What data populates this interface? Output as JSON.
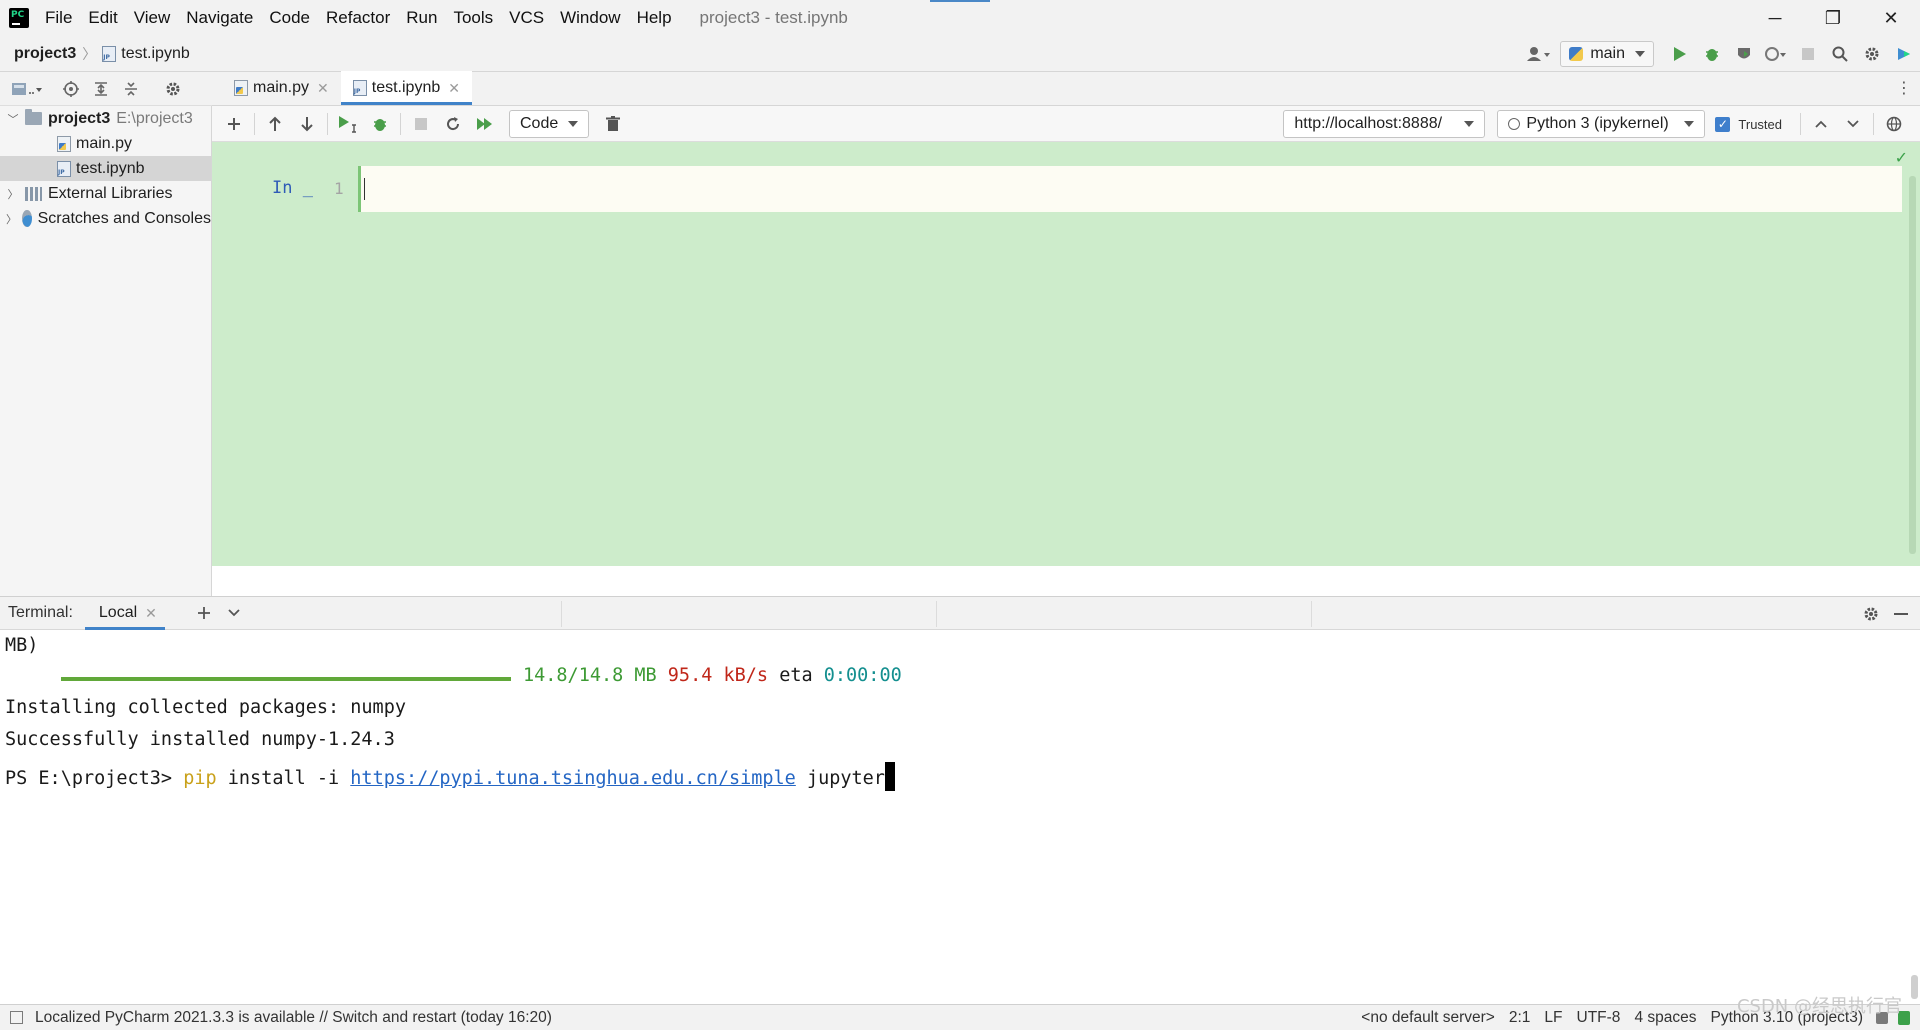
{
  "menubar": {
    "items": [
      "File",
      "Edit",
      "View",
      "Navigate",
      "Code",
      "Refactor",
      "Run",
      "Tools",
      "VCS",
      "Window",
      "Help"
    ],
    "window_title": "project3 - test.ipynb",
    "minimize": "─",
    "restore": "❐",
    "close": "✕"
  },
  "navbar": {
    "project": "project3",
    "separator": "〉",
    "file": "test.ipynb",
    "run_config": "main"
  },
  "project_panel": {
    "root_name": "project3",
    "root_path": "E:\\project3",
    "files": [
      "main.py",
      "test.ipynb"
    ],
    "selected": "test.ipynb",
    "external_libraries": "External Libraries",
    "scratches": "Scratches and Consoles"
  },
  "editor_tabs": [
    {
      "label": "main.py",
      "active": false
    },
    {
      "label": "test.ipynb",
      "active": true
    }
  ],
  "notebook_toolbar": {
    "cell_type": "Code",
    "server_url": "http://localhost:8888/",
    "kernel": "Python 3 (ipykernel)",
    "trusted_label": "Trusted",
    "trusted_checked": true
  },
  "notebook": {
    "cell_prompt": "In _",
    "line_number": "1",
    "cell_source": "",
    "background_color": "#cdeccb"
  },
  "terminal": {
    "title": "Terminal:",
    "tab": "Local",
    "line_mb": "MB)",
    "progress_fraction": 1.0,
    "progress_size": "14.8/14.8 MB",
    "progress_speed": "95.4 kB/s",
    "progress_eta_label": "eta",
    "progress_eta": "0:00:00",
    "line_installing": "Installing collected packages: numpy",
    "line_success": "Successfully installed numpy-1.24.3",
    "prompt": "PS E:\\project3> ",
    "cmd_pip": "pip",
    "cmd_args": " install -i ",
    "cmd_url": "https://pypi.tuna.tsinghua.edu.cn/simple",
    "cmd_pkg": " jupyter"
  },
  "statusbar": {
    "message": "Localized PyCharm 2021.3.3 is available // Switch and restart (today 16:20)",
    "server": "<no default server>",
    "position": "2:1",
    "line_sep": "LF",
    "encoding": "UTF-8",
    "indent": "4 spaces",
    "interpreter": "Python 3.10 (project3)",
    "watermark": "CSDN @经思执行官"
  },
  "colors": {
    "accent": "#4083c9",
    "notebook_bg": "#cdeccb",
    "progress": "#61a83a",
    "link": "#2466c4"
  }
}
